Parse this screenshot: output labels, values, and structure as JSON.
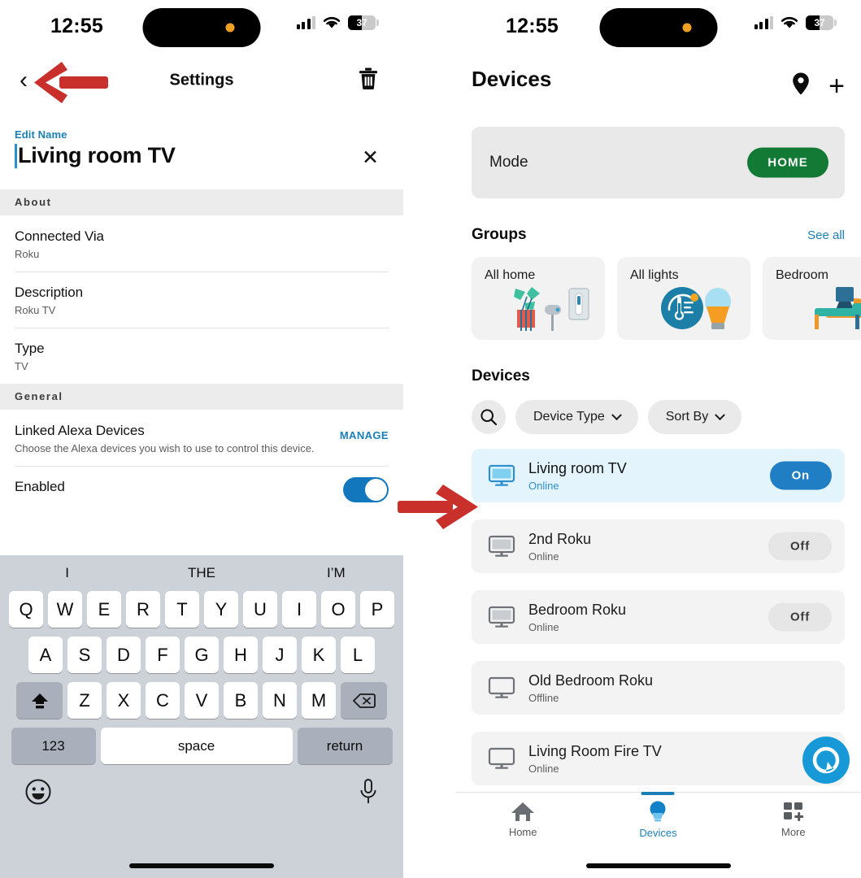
{
  "status_bar": {
    "time": "12:55",
    "battery_percent": "37",
    "signal_icon": "cellular-signal-icon",
    "wifi_icon": "wifi-icon",
    "battery_icon": "battery-icon"
  },
  "settings_screen": {
    "nav": {
      "back_icon": "chevron-left-icon",
      "title": "Settings",
      "delete_icon": "trash-icon"
    },
    "edit_name": {
      "label": "Edit Name",
      "value": "Living room TV",
      "clear_icon": "close-icon"
    },
    "sections": [
      {
        "header": "About",
        "rows": [
          {
            "title": "Connected Via",
            "subtitle": "Roku"
          },
          {
            "title": "Description",
            "subtitle": "Roku TV"
          },
          {
            "title": "Type",
            "subtitle": "TV"
          }
        ]
      },
      {
        "header": "General",
        "rows": [
          {
            "title": "Linked Alexa Devices",
            "subtitle": "Choose the Alexa devices you wish to use to control this device.",
            "action": "MANAGE"
          },
          {
            "title": "Enabled",
            "toggle": "on"
          }
        ]
      }
    ]
  },
  "keyboard": {
    "suggestions": [
      "I",
      "THE",
      "I’M"
    ],
    "row1": [
      "Q",
      "W",
      "E",
      "R",
      "T",
      "Y",
      "U",
      "I",
      "O",
      "P"
    ],
    "row2": [
      "A",
      "S",
      "D",
      "F",
      "G",
      "H",
      "J",
      "K",
      "L"
    ],
    "row3": [
      "Z",
      "X",
      "C",
      "V",
      "B",
      "N",
      "M"
    ],
    "shift_icon": "shift-icon",
    "backspace_icon": "backspace-icon",
    "numbers_key": "123",
    "space_key": "space",
    "return_key": "return",
    "emoji_icon": "emoji-icon",
    "dictation_icon": "microphone-icon"
  },
  "devices_screen": {
    "header": {
      "title": "Devices",
      "location_icon": "map-pin-icon",
      "add_icon": "plus-icon"
    },
    "mode_card": {
      "label": "Mode",
      "value": "HOME",
      "color": "#137a35"
    },
    "groups_section": {
      "title": "Groups",
      "see_all": "See all",
      "cards": [
        {
          "name": "All home",
          "art": "plants-switch-illustration"
        },
        {
          "name": "All lights",
          "art": "thermostat-bulb-illustration"
        },
        {
          "name": "Bedroom",
          "art": "bed-lamp-illustration"
        }
      ]
    },
    "devices_section": {
      "title": "Devices",
      "filters": {
        "search_icon": "search-icon",
        "device_type": "Device Type",
        "sort_by": "Sort By",
        "chevron_icon": "chevron-down-icon"
      },
      "rows": [
        {
          "name": "Living room TV",
          "status": "Online",
          "state": "On",
          "selected": true
        },
        {
          "name": "2nd Roku",
          "status": "Online",
          "state": "Off",
          "selected": false
        },
        {
          "name": "Bedroom Roku",
          "status": "Online",
          "state": "Off",
          "selected": false
        },
        {
          "name": "Old Bedroom Roku",
          "status": "Offline",
          "state": "",
          "selected": false
        },
        {
          "name": "Living Room Fire TV",
          "status": "Online",
          "state": "",
          "selected": false
        }
      ]
    },
    "alexa_button": "alexa-assistant-icon",
    "tab_bar": [
      {
        "label": "Home",
        "icon": "home-icon",
        "selected": false
      },
      {
        "label": "Devices",
        "icon": "bulb-icon",
        "selected": true
      },
      {
        "label": "More",
        "icon": "grid-plus-icon",
        "selected": false
      }
    ]
  },
  "annotations": {
    "color": "#c9302c",
    "left_arrow": "red-arrow-pointing-to-back-button",
    "right_arrow": "red-arrow-pointing-to-living-room-tv-row"
  }
}
